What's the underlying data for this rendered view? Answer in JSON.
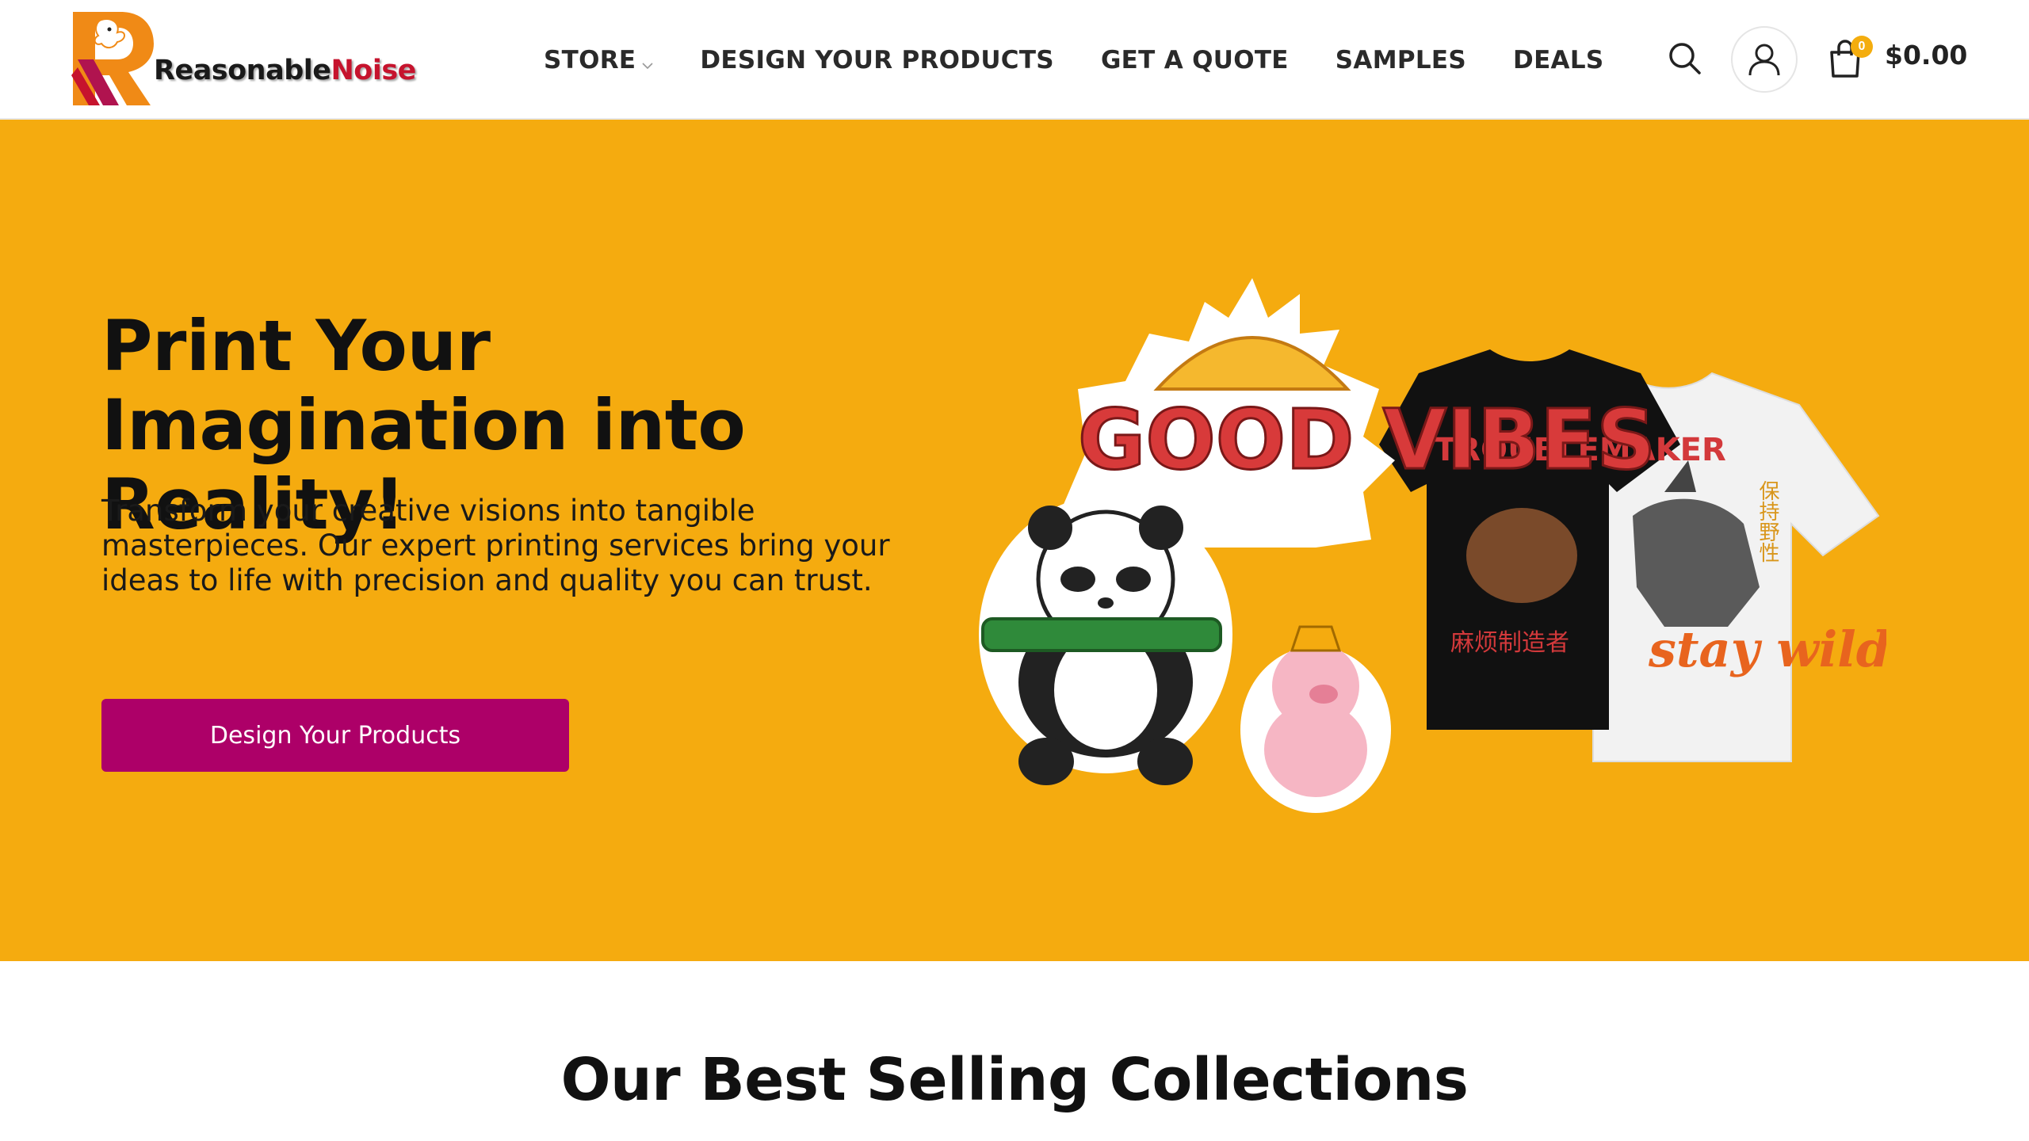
{
  "brand": {
    "name_part1": "Reasonable",
    "name_part2": "Noise"
  },
  "nav": {
    "items": [
      {
        "label": "STORE",
        "has_dropdown": true
      },
      {
        "label": "DESIGN YOUR PRODUCTS"
      },
      {
        "label": "GET A QUOTE"
      },
      {
        "label": "SAMPLES"
      },
      {
        "label": "DEALS"
      }
    ]
  },
  "header_icons": {
    "search": "search-icon",
    "account": "user-icon",
    "cart": "shopping-bag-icon"
  },
  "cart": {
    "count": "0",
    "total": "$0.00"
  },
  "hero": {
    "title": "Print Your Imagination into Reality!",
    "description": "Transform your creative visions into tangible masterpieces. Our expert printing services bring your ideas to life with precision and quality you can trust.",
    "cta_label": "Design Your Products",
    "art": {
      "sticker_text": "GOOD VIBES",
      "shirt1_text": "TROUBLEMAKER",
      "shirt1_cn": "麻烦制造者",
      "shirt2_text": "stay wild",
      "shirt2_cn": "保持野性"
    }
  },
  "section": {
    "title": "Our Best Selling Collections"
  },
  "colors": {
    "hero_bg": "#f5ab0f",
    "cta_bg": "#ad0068",
    "brand_red": "#c6132d",
    "badge": "#f4ad0e"
  }
}
